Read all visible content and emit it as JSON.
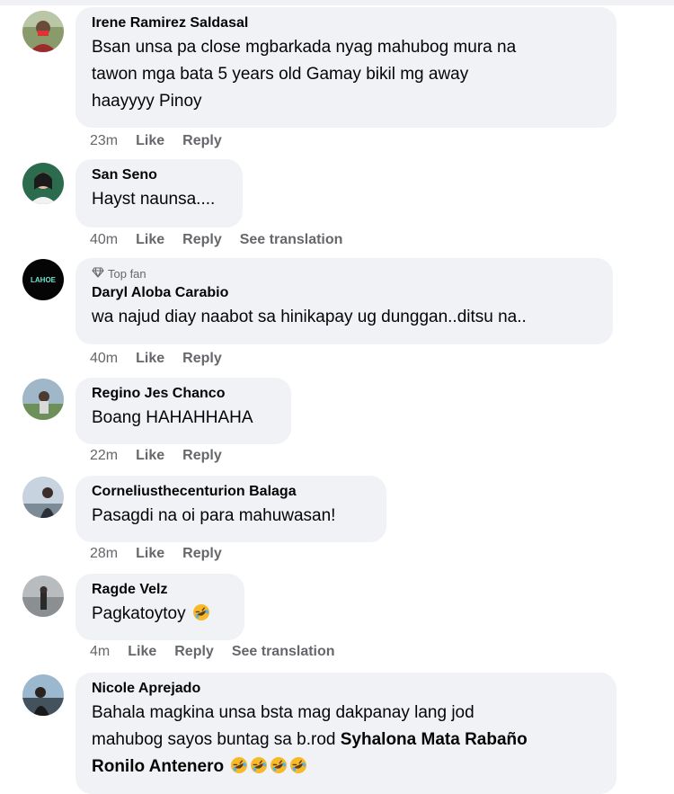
{
  "comments": [
    {
      "author": "Irene Ramirez Saldasal",
      "lines": [
        "Bsan unsa pa close mgbarkada nyag mahubog mura na",
        "tawon mga bata 5 years old Gamay bikil mg away",
        "haayyyy Pinoy"
      ],
      "time": "23m",
      "like": "Like",
      "reply": "Reply"
    },
    {
      "author": "San Seno",
      "lines": [
        "Hayst naunsa...."
      ],
      "time": "40m",
      "like": "Like",
      "reply": "Reply",
      "translate": "See translation"
    },
    {
      "badge": "Top fan",
      "author": "Daryl Aloba Carabio",
      "lines": [
        "wa najud diay naabot sa hinikapay ug dunggan..ditsu na.."
      ],
      "time": "40m",
      "like": "Like",
      "reply": "Reply",
      "avatar_text": "LAHOE"
    },
    {
      "author": "Regino Jes Chanco",
      "lines": [
        "Boang HAHAHHAHA"
      ],
      "time": "22m",
      "like": "Like",
      "reply": "Reply"
    },
    {
      "author": "Corneliusthecenturion Balaga",
      "lines": [
        "Pasagdi na oi para mahuwasan!"
      ],
      "time": "28m",
      "like": "Like",
      "reply": "Reply"
    },
    {
      "author": "Ragde Velz",
      "lines": [
        "Pagkatoytoy"
      ],
      "time": "4m",
      "like": "Like",
      "reply": "Reply",
      "translate": "See translation",
      "emoji": "rolling-laughing-emoji"
    },
    {
      "author": "Nicole Aprejado",
      "lines": [
        "Bahala magkina unsa bsta mag dakpanay lang jod",
        "mahubog sayos buntag sa b.rod"
      ],
      "tag1": "Syhalona Mata Rabaño",
      "tag2": "Ronilo Antenero",
      "emoji": "rolling-laughing-emoji"
    }
  ],
  "colors": {
    "bubble": "#f0f2f5",
    "meta": "#65676b",
    "text": "#050505"
  }
}
